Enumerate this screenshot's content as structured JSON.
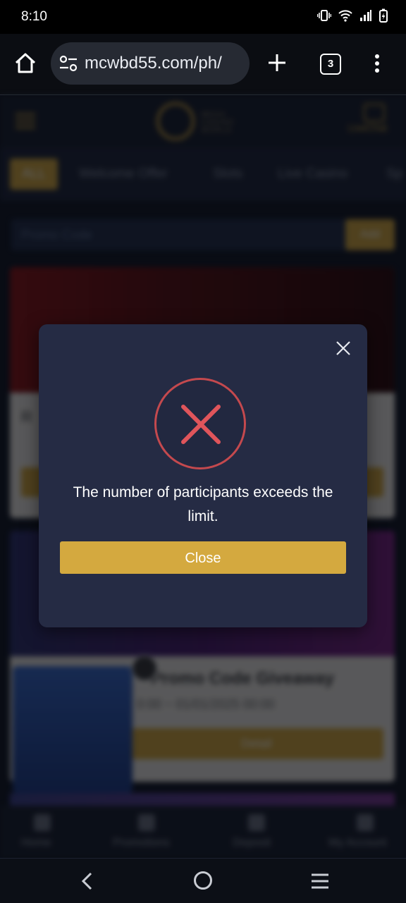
{
  "status_bar": {
    "time": "8:10"
  },
  "browser": {
    "url": "mcwbd55.com/ph/",
    "tab_count": "3"
  },
  "site": {
    "logo_text": "MEGA\nCASINO\nWORLD",
    "livechat": "LiveChat",
    "categories": [
      "ALL",
      "Welcome Offer",
      "Slots",
      "Live Casino",
      "Sp"
    ],
    "promo_code_placeholder": "Promo Code",
    "promo_add": "Add",
    "card1_title": "R",
    "card2_title": "Promo Code Giveaway",
    "card2_date": "0:00 ~ 01/01/2025 00:00",
    "card2_button": "Detail",
    "bottom_nav": [
      "Home",
      "Promotions",
      "Deposit",
      "My Account"
    ]
  },
  "modal": {
    "message": "The number of participants exceeds the limit.",
    "button_label": "Close"
  },
  "colors": {
    "accent": "#d4a93f",
    "error": "#c4494e",
    "modal_bg": "#252b44"
  }
}
